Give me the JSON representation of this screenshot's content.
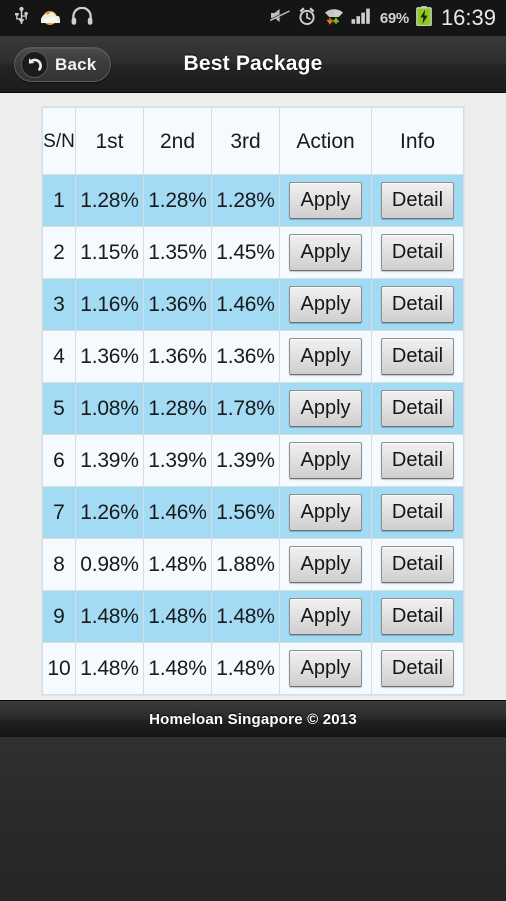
{
  "status_bar": {
    "left_icons": [
      "usb-icon",
      "weather-sunrise-icon",
      "headphones-icon"
    ],
    "right_icons": [
      "mute-icon",
      "alarm-icon",
      "wifi-data-icon",
      "signal-bars-icon"
    ],
    "battery_percent": "69%",
    "battery_icon": "battery-charging-icon",
    "time": "16:39"
  },
  "title_bar": {
    "back_label": "Back",
    "back_icon": "back-arrow-icon",
    "title": "Best Package"
  },
  "table": {
    "headers": [
      "S/\nN",
      "1st",
      "2nd",
      "3rd",
      "Action",
      "Info"
    ],
    "header_sn": "S/N",
    "header_1st": "1st",
    "header_2nd": "2nd",
    "header_3rd": "3rd",
    "header_action": "Action",
    "header_info": "Info",
    "action_label": "Apply",
    "info_label": "Detail",
    "rows": [
      {
        "sn": "1",
        "r1": "1.28%",
        "r2": "1.28%",
        "r3": "1.28%",
        "action": "Apply",
        "info": "Detail",
        "highlighted": true
      },
      {
        "sn": "2",
        "r1": "1.15%",
        "r2": "1.35%",
        "r3": "1.45%",
        "action": "Apply",
        "info": "Detail",
        "highlighted": false
      },
      {
        "sn": "3",
        "r1": "1.16%",
        "r2": "1.36%",
        "r3": "1.46%",
        "action": "Apply",
        "info": "Detail",
        "highlighted": true
      },
      {
        "sn": "4",
        "r1": "1.36%",
        "r2": "1.36%",
        "r3": "1.36%",
        "action": "Apply",
        "info": "Detail",
        "highlighted": false
      },
      {
        "sn": "5",
        "r1": "1.08%",
        "r2": "1.28%",
        "r3": "1.78%",
        "action": "Apply",
        "info": "Detail",
        "highlighted": true
      },
      {
        "sn": "6",
        "r1": "1.39%",
        "r2": "1.39%",
        "r3": "1.39%",
        "action": "Apply",
        "info": "Detail",
        "highlighted": false
      },
      {
        "sn": "7",
        "r1": "1.26%",
        "r2": "1.46%",
        "r3": "1.56%",
        "action": "Apply",
        "info": "Detail",
        "highlighted": true
      },
      {
        "sn": "8",
        "r1": "0.98%",
        "r2": "1.48%",
        "r3": "1.88%",
        "action": "Apply",
        "info": "Detail",
        "highlighted": false
      },
      {
        "sn": "9",
        "r1": "1.48%",
        "r2": "1.48%",
        "r3": "1.48%",
        "action": "Apply",
        "info": "Detail",
        "highlighted": true
      },
      {
        "sn": "10",
        "r1": "1.48%",
        "r2": "1.48%",
        "r3": "1.48%",
        "action": "Apply",
        "info": "Detail",
        "highlighted": false
      }
    ]
  },
  "footer": {
    "text": "Homeloan Singapore © 2013"
  },
  "colors": {
    "row_highlight": "#a3dbf5",
    "row_normal": "#f4fafe",
    "page_background": "#eeeeee",
    "chrome_dark": "#2b2b2b",
    "battery_green": "#8ccc1c"
  }
}
